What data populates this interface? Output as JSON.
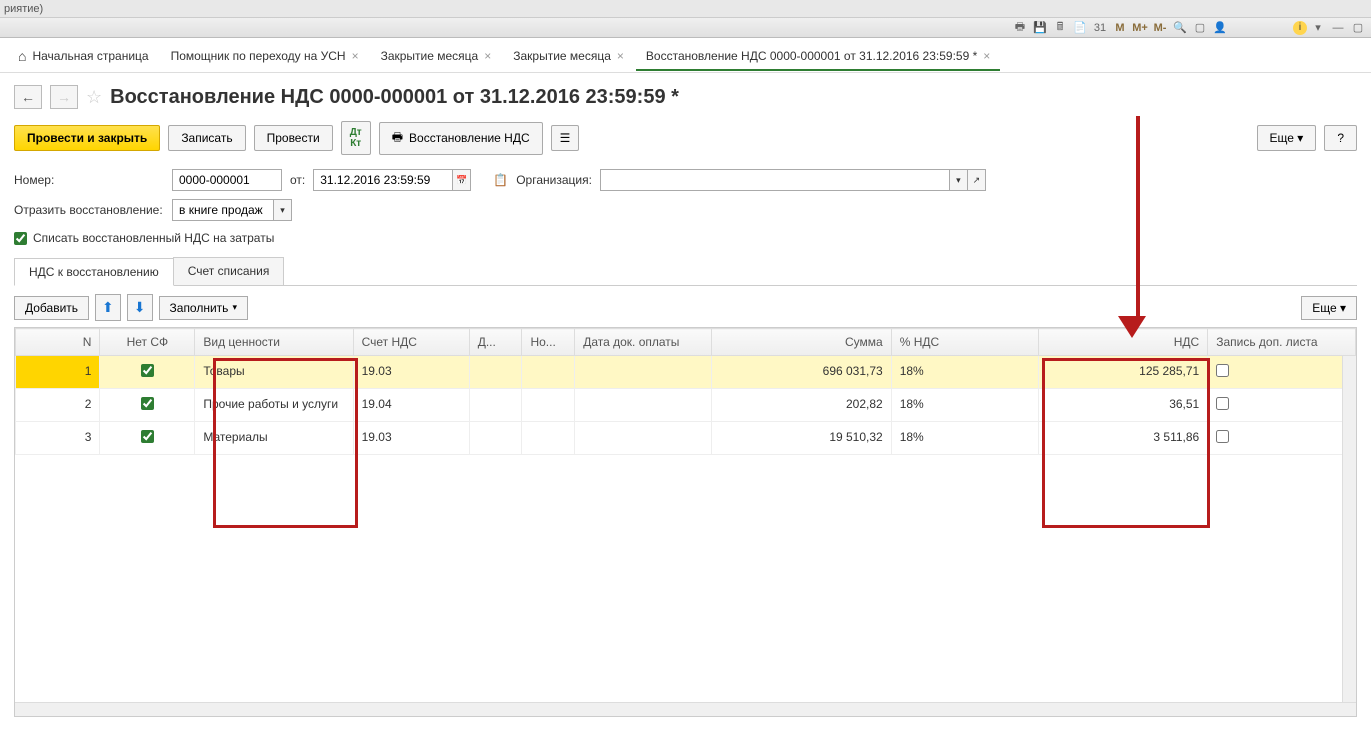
{
  "window": {
    "title_fragment": "риятие)"
  },
  "tabs": [
    {
      "label": "Начальная страница",
      "closable": false,
      "home": true
    },
    {
      "label": "Помощник по переходу на УСН",
      "closable": true
    },
    {
      "label": "Закрытие месяца",
      "closable": true
    },
    {
      "label": "Закрытие месяца",
      "closable": true
    },
    {
      "label": "Восстановление НДС 0000-000001 от 31.12.2016 23:59:59 *",
      "closable": true,
      "active": true
    }
  ],
  "doc": {
    "title": "Восстановление НДС 0000-000001 от 31.12.2016 23:59:59 *"
  },
  "actions": {
    "submit_close": "Провести и закрыть",
    "save": "Записать",
    "submit": "Провести",
    "report": "Восстановление НДС",
    "more": "Еще",
    "help": "?"
  },
  "form": {
    "number_label": "Номер:",
    "number_value": "0000-000001",
    "date_label": "от:",
    "date_value": "31.12.2016 23:59:59",
    "org_label": "Организация:",
    "org_value": "",
    "reflect_label": "Отразить восстановление:",
    "reflect_value": "в книге продаж",
    "writeoff_checkbox": "Списать восстановленный НДС на затраты"
  },
  "inner_tabs": {
    "tab1": "НДС к восстановлению",
    "tab2": "Счет списания"
  },
  "table_toolbar": {
    "add": "Добавить",
    "fill": "Заполнить",
    "more": "Еще"
  },
  "table": {
    "headers": {
      "n": "N",
      "no_sf": "Нет СФ",
      "kind": "Вид ценности",
      "acct": "Счет НДС",
      "d": "Д...",
      "no": "Но...",
      "paydate": "Дата док. оплаты",
      "sum": "Сумма",
      "vat_pct": "% НДС",
      "nds": "НДС",
      "extra": "Запись доп. листа"
    },
    "rows": [
      {
        "n": "1",
        "checked": true,
        "kind": "Товары",
        "acct": "19.03",
        "sum": "696 031,73",
        "vat": "18%",
        "nds": "125 285,71",
        "extra_checked": false,
        "selected": true
      },
      {
        "n": "2",
        "checked": true,
        "kind": "Прочие работы и услуги",
        "acct": "19.04",
        "sum": "202,82",
        "vat": "18%",
        "nds": "36,51",
        "extra_checked": false
      },
      {
        "n": "3",
        "checked": true,
        "kind": "Материалы",
        "acct": "19.03",
        "sum": "19 510,32",
        "vat": "18%",
        "nds": "3 511,86",
        "extra_checked": false
      }
    ]
  },
  "top_icons": {
    "m": "M",
    "mplus": "M+",
    "mminus": "M-",
    "cal": "31"
  }
}
